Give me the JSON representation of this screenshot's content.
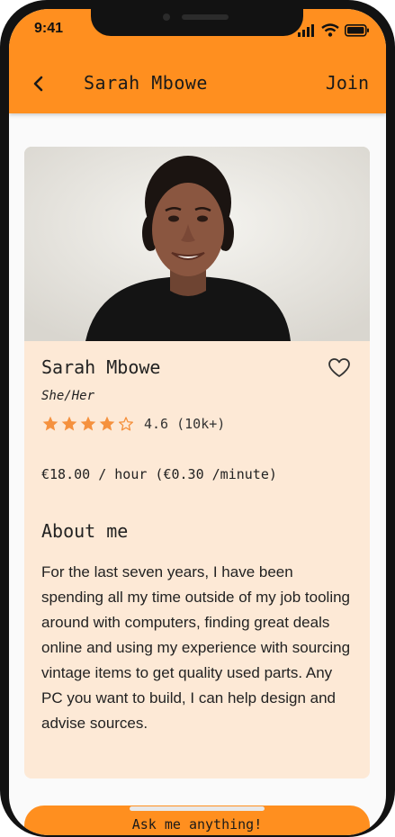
{
  "status_bar": {
    "time": "9:41"
  },
  "header": {
    "title": "Sarah Mbowe",
    "action_label": "Join",
    "back_icon": "chevron-left-icon",
    "background_color": "#ff8f1f"
  },
  "profile": {
    "name": "Sarah Mbowe",
    "pronouns": "She/Her",
    "rating_value": 4.6,
    "rating_text": "4.6 (10k+)",
    "stars_filled": 4,
    "stars_total": 5,
    "price_text": "€18.00 / hour (€0.30 /minute)",
    "favorite_icon": "heart-outline-icon",
    "card_color": "#fde9d6",
    "star_color": "#f5913e"
  },
  "about": {
    "title": "About me",
    "text": "For the last seven years, I have been spending all my time outside of my job tooling around with computers, finding great deals online and using my experience with sourcing vintage items to get quality used parts. Any PC you want to build, I can help design and advise sources."
  },
  "cta": {
    "label": "Ask me anything!"
  }
}
